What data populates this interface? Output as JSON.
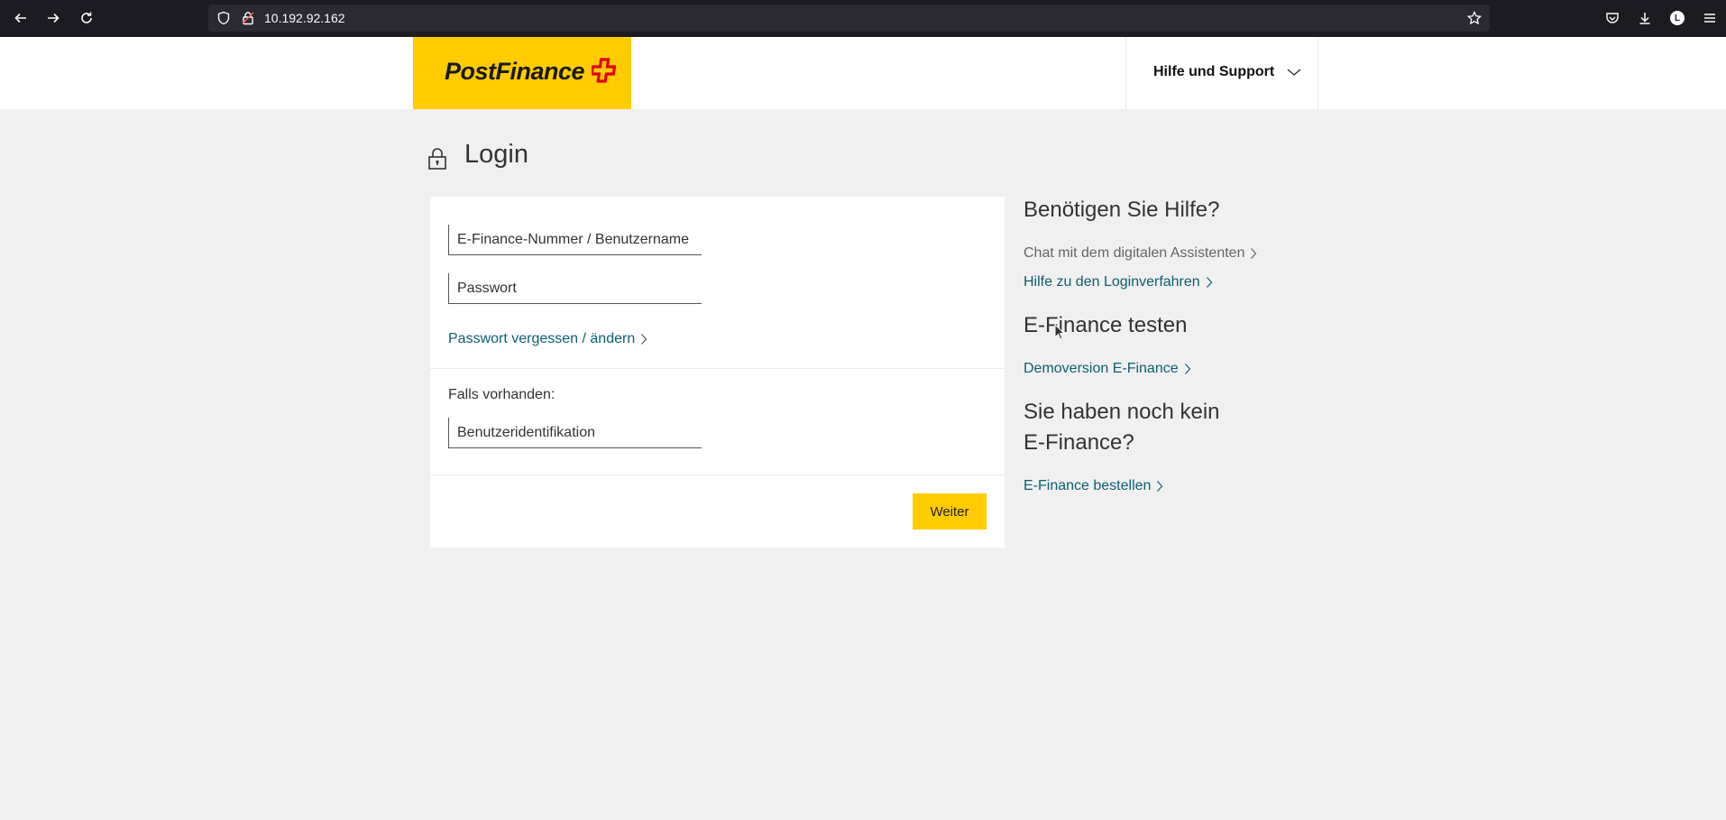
{
  "browser": {
    "url": "10.192.92.162",
    "profile_initial": "L"
  },
  "header": {
    "logo_text": "PostFinance",
    "help_label": "Hilfe und Support"
  },
  "main": {
    "title": "Login",
    "fields": {
      "username_placeholder": "E-Finance-Nummer / Benutzername",
      "password_placeholder": "Passwort",
      "userid_placeholder": "Benutzeridentifikation"
    },
    "forgot_link": "Passwort vergessen / ändern",
    "optional_label": "Falls vorhanden:",
    "submit_label": "Weiter"
  },
  "side": {
    "help_heading": "Benötigen Sie Hilfe?",
    "chat_link": "Chat mit dem digitalen Assistenten",
    "login_help_link": "Hilfe zu den Loginverfahren",
    "test_heading": "E-Finance testen",
    "demo_link": "Demoversion E-Finance",
    "no_account_heading_line1": "Sie haben noch kein",
    "no_account_heading_line2": "E-Finance?",
    "order_link": "E-Finance bestellen"
  },
  "colors": {
    "brand_yellow": "#ffcc00",
    "link_teal": "#0b5e72",
    "brand_red": "#e2001a"
  },
  "icons": [
    "back-icon",
    "forward-icon",
    "reload-icon",
    "shield-icon",
    "lock-icon",
    "star-icon",
    "pocket-icon",
    "download-icon",
    "menu-icon",
    "chevron-down-icon",
    "chevron-right-icon"
  ]
}
